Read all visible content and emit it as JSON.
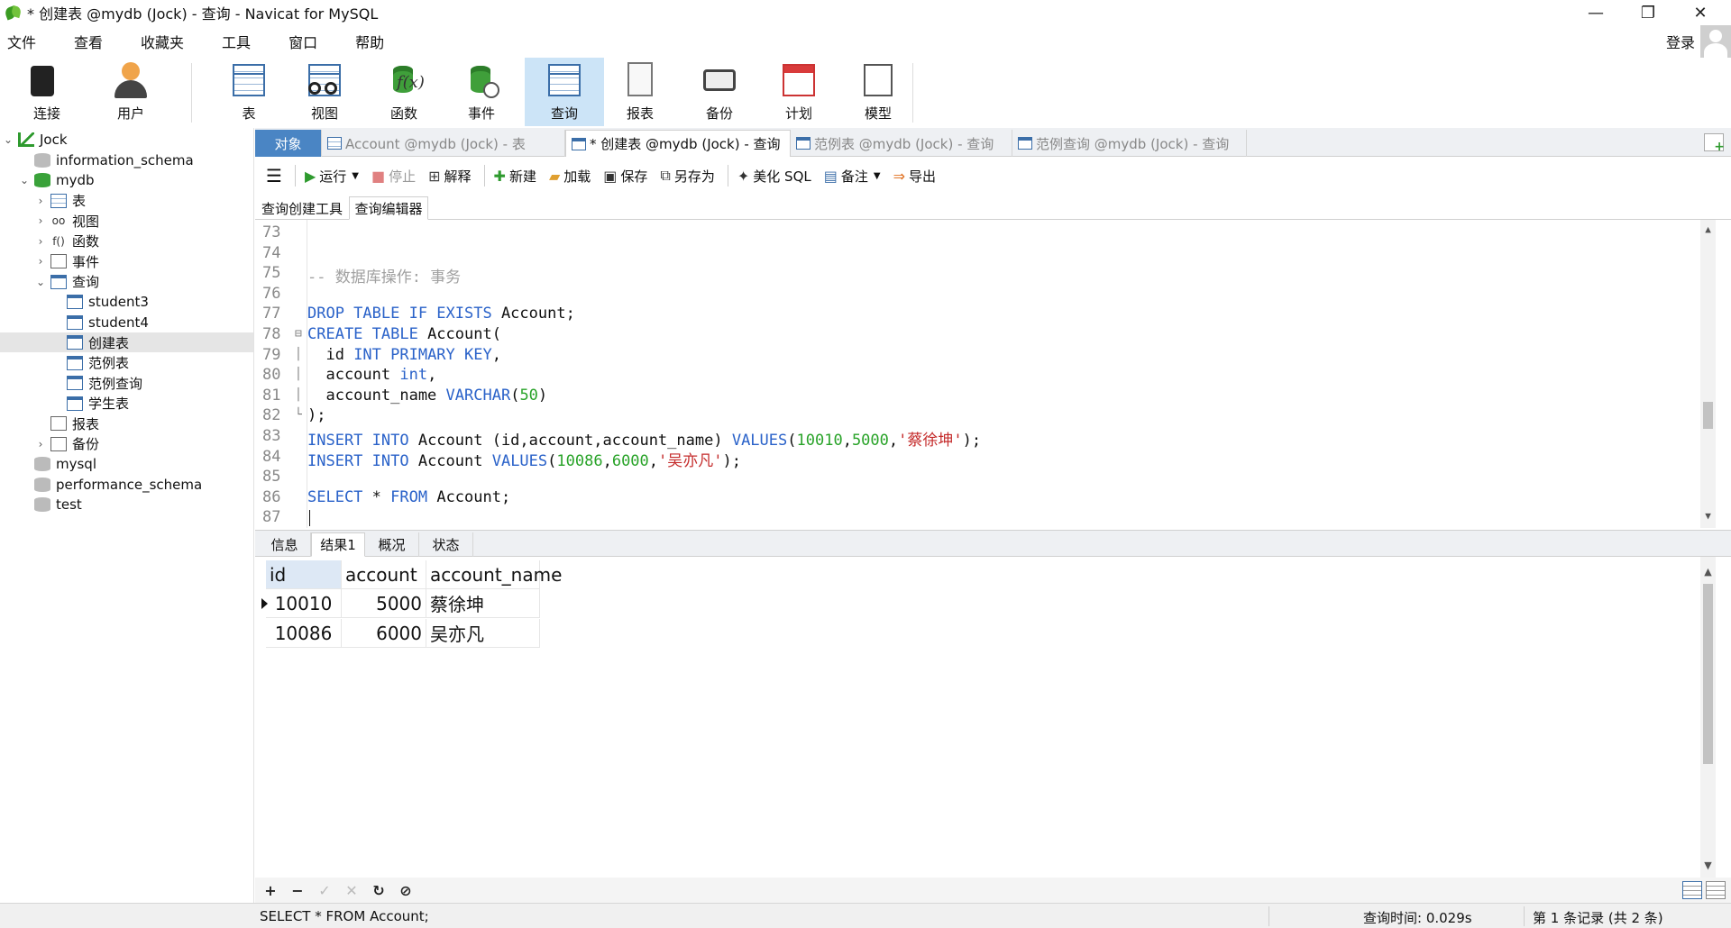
{
  "window": {
    "title": "* 创建表 @mydb (Jock) - 查询 - Navicat for MySQL",
    "controls": {
      "minimize": "—",
      "restore": "❐",
      "close": "✕"
    }
  },
  "menu": [
    "文件",
    "查看",
    "收藏夹",
    "工具",
    "窗口",
    "帮助"
  ],
  "login_label": "登录",
  "toolbar": [
    {
      "label": "连接",
      "icon": "connection-icon"
    },
    {
      "label": "用户",
      "icon": "user-icon"
    },
    {
      "label": "表",
      "icon": "table-icon"
    },
    {
      "label": "视图",
      "icon": "view-icon"
    },
    {
      "label": "函数",
      "icon": "function-icon",
      "glyph": "f(x)"
    },
    {
      "label": "事件",
      "icon": "event-icon"
    },
    {
      "label": "查询",
      "icon": "query-icon",
      "active": true
    },
    {
      "label": "报表",
      "icon": "report-icon"
    },
    {
      "label": "备份",
      "icon": "backup-icon"
    },
    {
      "label": "计划",
      "icon": "schedule-icon"
    },
    {
      "label": "模型",
      "icon": "model-icon"
    }
  ],
  "tree": [
    {
      "label": "Jock",
      "level": 0,
      "twisty": "v",
      "icon": "conn"
    },
    {
      "label": "information_schema",
      "level": 1,
      "twisty": "",
      "icon": "db"
    },
    {
      "label": "mydb",
      "level": 1,
      "twisty": "v",
      "icon": "db-green"
    },
    {
      "label": "表",
      "level": 2,
      "twisty": ">",
      "icon": "tbl"
    },
    {
      "label": "视图",
      "level": 2,
      "twisty": ">",
      "icon": "txt",
      "glyph": "oo"
    },
    {
      "label": "函数",
      "level": 2,
      "twisty": ">",
      "icon": "txt",
      "glyph": "f()"
    },
    {
      "label": "事件",
      "level": 2,
      "twisty": ">",
      "icon": "gen"
    },
    {
      "label": "查询",
      "level": 2,
      "twisty": "v",
      "icon": "qry"
    },
    {
      "label": "student3",
      "level": 3,
      "twisty": "",
      "icon": "qry"
    },
    {
      "label": "student4",
      "level": 3,
      "twisty": "",
      "icon": "qry"
    },
    {
      "label": "创建表",
      "level": 3,
      "twisty": "",
      "icon": "qry",
      "selected": true
    },
    {
      "label": "范例表",
      "level": 3,
      "twisty": "",
      "icon": "qry"
    },
    {
      "label": "范例查询",
      "level": 3,
      "twisty": "",
      "icon": "qry"
    },
    {
      "label": "学生表",
      "level": 3,
      "twisty": "",
      "icon": "qry"
    },
    {
      "label": "报表",
      "level": 2,
      "twisty": "",
      "icon": "gen"
    },
    {
      "label": "备份",
      "level": 2,
      "twisty": ">",
      "icon": "gen"
    },
    {
      "label": "mysql",
      "level": 1,
      "twisty": "",
      "icon": "db"
    },
    {
      "label": "performance_schema",
      "level": 1,
      "twisty": "",
      "icon": "db"
    },
    {
      "label": "test",
      "level": 1,
      "twisty": "",
      "icon": "db"
    }
  ],
  "tabs": [
    {
      "label": "对象",
      "kind": "obj"
    },
    {
      "label": "Account @mydb (Jock) - 表",
      "kind": "tbl"
    },
    {
      "label": "* 创建表 @mydb (Jock) - 查询",
      "kind": "cur"
    },
    {
      "label": "范例表 @mydb (Jock) - 查询",
      "kind": "qry"
    },
    {
      "label": "范例查询 @mydb (Jock) - 查询",
      "kind": "qry"
    }
  ],
  "query_toolbar": [
    {
      "label": "运行",
      "glyph": "▶",
      "color": "#2e9a2e",
      "dropdown": true
    },
    {
      "label": "停止",
      "glyph": "■",
      "color": "#e08080",
      "disabled": true
    },
    {
      "label": "解释",
      "glyph": "⊞",
      "color": "#444"
    },
    {
      "label": "新建",
      "glyph": "✚",
      "color": "#2e9a2e",
      "sep_before": true
    },
    {
      "label": "加载",
      "glyph": "▰",
      "color": "#e0a030"
    },
    {
      "label": "保存",
      "glyph": "▣",
      "color": "#333"
    },
    {
      "label": "另存为",
      "glyph": "⧉",
      "color": "#333"
    },
    {
      "label": "美化 SQL",
      "glyph": "✦",
      "color": "#333",
      "sep_before": true
    },
    {
      "label": "备注",
      "glyph": "▤",
      "color": "#3b6ea8",
      "dropdown": true
    },
    {
      "label": "导出",
      "glyph": "⇒",
      "color": "#e07020"
    }
  ],
  "sub_tabs": [
    "查询创建工具",
    "查询编辑器"
  ],
  "editor": {
    "lines": [
      {
        "n": "73",
        "t": ""
      },
      {
        "n": "74",
        "t": ""
      },
      {
        "n": "75",
        "t": "<span class='cm'>-- 数据库操作: 事务</span>"
      },
      {
        "n": "76",
        "t": ""
      },
      {
        "n": "77",
        "t": "<span class='kw'>DROP TABLE IF EXISTS</span> Account;"
      },
      {
        "n": "78",
        "t": "<span class='kw'>CREATE TABLE</span> Account(",
        "fold": "⊟"
      },
      {
        "n": "79",
        "t": "  id <span class='kw'>INT PRIMARY KEY</span>,",
        "fold": "│"
      },
      {
        "n": "80",
        "t": "  account <span class='kw'>int</span>,",
        "fold": "│"
      },
      {
        "n": "81",
        "t": "  account_name <span class='kw'>VARCHAR</span>(<span class='num'>50</span>)",
        "fold": "│"
      },
      {
        "n": "82",
        "t": ");",
        "fold": "└"
      },
      {
        "n": "83",
        "t": "<span class='kw'>INSERT INTO</span> Account (id,account,account_name) <span class='kw'>VALUES</span>(<span class='num'>10010</span>,<span class='num'>5000</span>,<span class='str'>'蔡徐坤'</span>);"
      },
      {
        "n": "84",
        "t": "<span class='kw'>INSERT INTO</span> Account <span class='kw'>VALUES</span>(<span class='num'>10086</span>,<span class='num'>6000</span>,<span class='str'>'吴亦凡'</span>);"
      },
      {
        "n": "85",
        "t": ""
      },
      {
        "n": "86",
        "t": "<span class='kw'>SELECT</span> * <span class='kw'>FROM</span> Account;"
      },
      {
        "n": "87",
        "t": ""
      }
    ],
    "caret_line": 15
  },
  "result_tabs": [
    "信息",
    "结果1",
    "概况",
    "状态"
  ],
  "result_active": 1,
  "grid": {
    "columns": [
      "id",
      "account",
      "account_name"
    ],
    "rows": [
      [
        "10010",
        "5000",
        "蔡徐坤"
      ],
      [
        "10086",
        "6000",
        "吴亦凡"
      ]
    ]
  },
  "nav_buttons": [
    {
      "glyph": "+",
      "name": "add-record-button"
    },
    {
      "glyph": "−",
      "name": "delete-record-button"
    },
    {
      "glyph": "✓",
      "name": "apply-button",
      "disabled": true
    },
    {
      "glyph": "✕",
      "name": "discard-button",
      "disabled": true
    },
    {
      "glyph": "↻",
      "name": "refresh-button"
    },
    {
      "glyph": "⊘",
      "name": "stop-button"
    }
  ],
  "status": {
    "sql": "SELECT * FROM Account;",
    "query_time": "查询时间: 0.029s",
    "records": "第 1 条记录 (共 2 条)"
  },
  "colors": {
    "accent": "#4a85c4",
    "keyword": "#2a62c9",
    "number": "#29a329",
    "string": "#c42b2b",
    "comment": "#a0a0a0"
  }
}
